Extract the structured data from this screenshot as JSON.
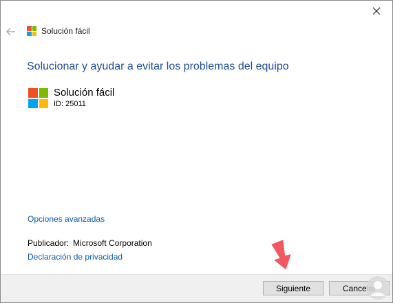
{
  "window": {
    "close_glyph": "✕",
    "back_glyph": "←"
  },
  "app": {
    "title": "Solución fácil"
  },
  "main": {
    "heading": "Solucionar y ayudar a evitar los problemas del equipo",
    "troubleshooter_name": "Solución fácil",
    "troubleshooter_id": "ID: 25011",
    "advanced_link": "Opciones avanzadas",
    "publisher_label": "Publicador:",
    "publisher_value": "Microsoft Corporation",
    "privacy_link": "Declaración de privacidad"
  },
  "footer": {
    "next_label": "Siguiente",
    "cancel_label": "Cancelar"
  },
  "icons": {
    "logo": "microsoft-logo-icon",
    "close": "close-icon",
    "back": "back-arrow-icon",
    "pointer": "pointer-arrow-icon",
    "watermark": "watermark-logo-icon"
  },
  "colors": {
    "heading": "#1f4e9a",
    "link": "#0a5cae",
    "footer_bg": "#f0f0f0",
    "logo_red": "#f25022",
    "logo_green": "#7fba00",
    "logo_blue": "#00a4ef",
    "logo_yellow": "#ffb900",
    "pointer": "#ee5a5f"
  }
}
